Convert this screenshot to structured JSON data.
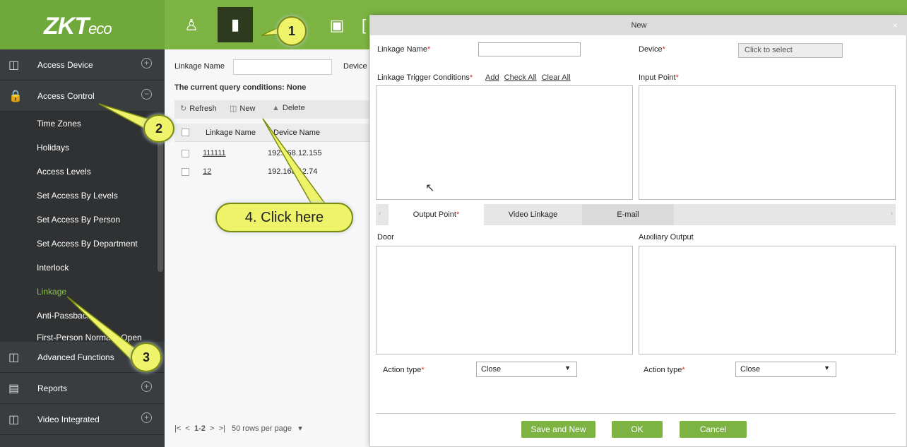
{
  "app": {
    "logo_main": "ZKT",
    "logo_sub": "eco"
  },
  "topbar": {
    "user_frag": "1"
  },
  "sidebar": {
    "sections": [
      {
        "label": "Access Device",
        "toggle": "+"
      },
      {
        "label": "Access Control",
        "toggle": "−"
      }
    ],
    "items": [
      {
        "label": "Time Zones"
      },
      {
        "label": "Holidays"
      },
      {
        "label": "Access Levels"
      },
      {
        "label": "Set Access By Levels"
      },
      {
        "label": "Set Access By Person"
      },
      {
        "label": "Set Access By Department"
      },
      {
        "label": "Interlock"
      },
      {
        "label": "Linkage"
      },
      {
        "label": "Anti-Passback"
      },
      {
        "label": "First-Person Normally Open"
      }
    ],
    "bottom_sections": [
      {
        "label": "Advanced Functions",
        "toggle": "+"
      },
      {
        "label": "Reports",
        "toggle": "+"
      },
      {
        "label": "Video Integrated",
        "toggle": "+"
      }
    ]
  },
  "main": {
    "filter_label": "Linkage Name",
    "device_label": "Device",
    "query_conditions": "The current query conditions: None",
    "toolbar": {
      "refresh": "Refresh",
      "new": "New",
      "delete": "Delete"
    },
    "columns": [
      "Linkage Name",
      "Device Name"
    ],
    "rows": [
      {
        "name": "111111",
        "device": "192.168.12.155"
      },
      {
        "name": "12",
        "device": "192.168.12.74"
      }
    ],
    "pager": {
      "range": "1-2",
      "per_page": "50 rows per page"
    }
  },
  "dialog": {
    "title": "New",
    "linkage_name_label": "Linkage Name",
    "device_label": "Device",
    "device_placeholder": "Click to select",
    "trigger_label": "Linkage Trigger Conditions",
    "trigger_links": {
      "add": "Add",
      "check_all": "Check All",
      "clear_all": "Clear All"
    },
    "input_point_label": "Input Point",
    "tabs": [
      "Output Point",
      "Video Linkage",
      "E-mail"
    ],
    "door_label": "Door",
    "aux_label": "Auxiliary Output",
    "action_type_label": "Action type",
    "action_type_value_left": "Close",
    "action_type_value_right": "Close",
    "buttons": {
      "save_new": "Save and New",
      "ok": "OK",
      "cancel": "Cancel"
    },
    "required_mark": "*"
  },
  "callouts": {
    "c1": "1",
    "c2": "2",
    "c3": "3",
    "c4": "4. Click here"
  },
  "colors": {
    "accent": "#7cb342",
    "sidebar": "#3a3d3f",
    "active_item": "#8bc34a",
    "callout": "#eef36a"
  }
}
